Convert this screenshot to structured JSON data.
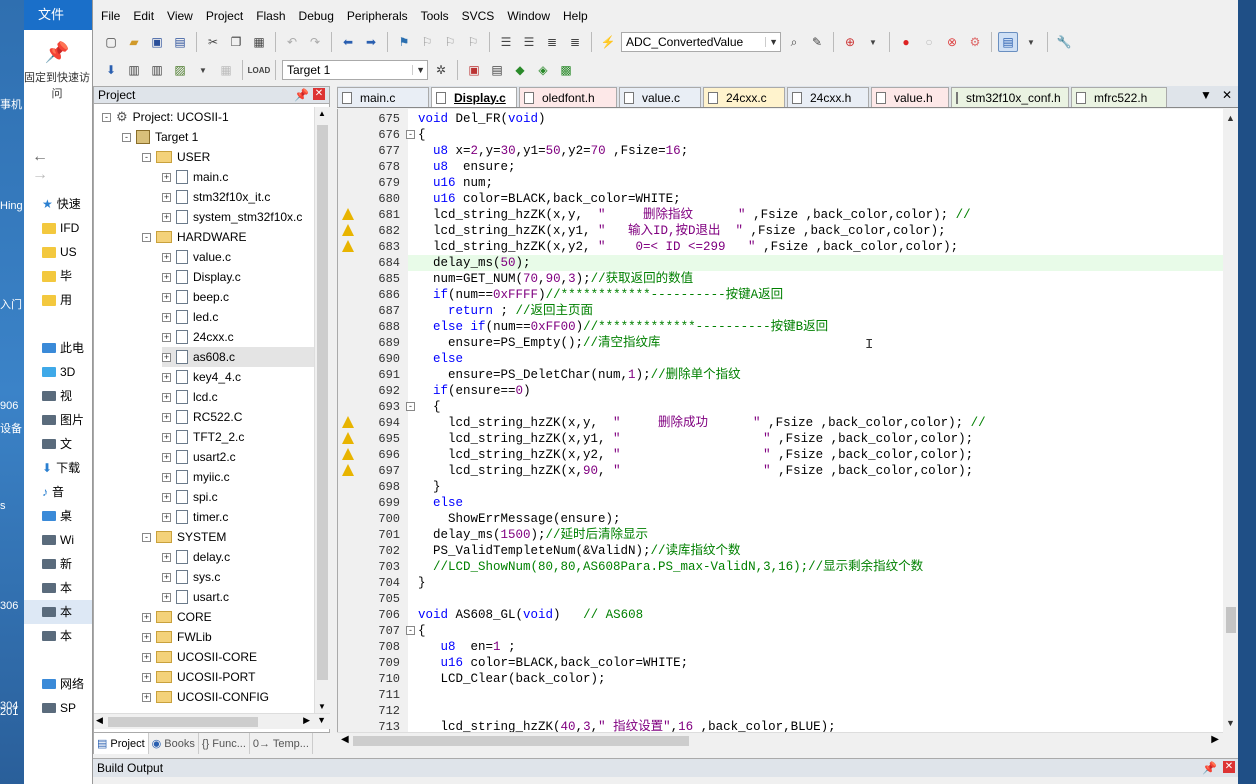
{
  "explorer": {
    "file_tab": "文件",
    "pin_label": "固定到快速访问",
    "nav_back": "←",
    "nav_fwd": "→",
    "items": [
      {
        "label": "快速",
        "kind": "star"
      },
      {
        "label": "IFD",
        "kind": "folder"
      },
      {
        "label": "US",
        "kind": "folder"
      },
      {
        "label": "毕",
        "kind": "folder"
      },
      {
        "label": "用",
        "kind": "folder"
      },
      {
        "label": "",
        "kind": "blank"
      },
      {
        "label": "此电",
        "kind": "pc"
      },
      {
        "label": "3D",
        "kind": "obj"
      },
      {
        "label": "视",
        "kind": "video"
      },
      {
        "label": "图片",
        "kind": "pics"
      },
      {
        "label": "文",
        "kind": "doc"
      },
      {
        "label": "下载",
        "kind": "down"
      },
      {
        "label": "音",
        "kind": "music"
      },
      {
        "label": "桌",
        "kind": "desk"
      },
      {
        "label": "Wi",
        "kind": "drive"
      },
      {
        "label": "新",
        "kind": "drive"
      },
      {
        "label": "本",
        "kind": "drive"
      },
      {
        "label": "本",
        "kind": "drive",
        "selected": true
      },
      {
        "label": "本",
        "kind": "drive"
      },
      {
        "label": "",
        "kind": "blank"
      },
      {
        "label": "网络",
        "kind": "net"
      },
      {
        "label": "SP",
        "kind": "drive"
      }
    ]
  },
  "desktop_labels": [
    "事机",
    "Hing",
    "入门",
    "906",
    "设备",
    "s",
    "306",
    "304",
    "201"
  ],
  "menu": [
    "File",
    "Edit",
    "View",
    "Project",
    "Flash",
    "Debug",
    "Peripherals",
    "Tools",
    "SVCS",
    "Window",
    "Help"
  ],
  "toolbar": {
    "find_combo": "ADC_ConvertedValue",
    "target_combo": "Target 1"
  },
  "project_pane": {
    "title": "Project",
    "tree": [
      {
        "label": "Project: UCOSII-1",
        "level": 0,
        "kind": "project",
        "exp": "-"
      },
      {
        "label": "Target 1",
        "level": 1,
        "kind": "target",
        "exp": "-"
      },
      {
        "label": "USER",
        "level": 2,
        "kind": "folder",
        "exp": "-"
      },
      {
        "label": "main.c",
        "level": 3,
        "kind": "file",
        "exp": "+"
      },
      {
        "label": "stm32f10x_it.c",
        "level": 3,
        "kind": "file",
        "exp": "+"
      },
      {
        "label": "system_stm32f10x.c",
        "level": 3,
        "kind": "file",
        "exp": "+"
      },
      {
        "label": "HARDWARE",
        "level": 2,
        "kind": "folder",
        "exp": "-"
      },
      {
        "label": "value.c",
        "level": 3,
        "kind": "file",
        "exp": "+"
      },
      {
        "label": "Display.c",
        "level": 3,
        "kind": "file",
        "exp": "+"
      },
      {
        "label": "beep.c",
        "level": 3,
        "kind": "file",
        "exp": "+"
      },
      {
        "label": "led.c",
        "level": 3,
        "kind": "file",
        "exp": "+"
      },
      {
        "label": "24cxx.c",
        "level": 3,
        "kind": "file",
        "exp": "+"
      },
      {
        "label": "as608.c",
        "level": 3,
        "kind": "file",
        "exp": "+",
        "selected": true
      },
      {
        "label": "key4_4.c",
        "level": 3,
        "kind": "file",
        "exp": "+"
      },
      {
        "label": "lcd.c",
        "level": 3,
        "kind": "file",
        "exp": "+"
      },
      {
        "label": "RC522.C",
        "level": 3,
        "kind": "file",
        "exp": "+"
      },
      {
        "label": "TFT2_2.c",
        "level": 3,
        "kind": "file",
        "exp": "+"
      },
      {
        "label": "usart2.c",
        "level": 3,
        "kind": "file",
        "exp": "+"
      },
      {
        "label": "myiic.c",
        "level": 3,
        "kind": "file",
        "exp": "+"
      },
      {
        "label": "spi.c",
        "level": 3,
        "kind": "file",
        "exp": "+"
      },
      {
        "label": "timer.c",
        "level": 3,
        "kind": "file",
        "exp": "+"
      },
      {
        "label": "SYSTEM",
        "level": 2,
        "kind": "folder",
        "exp": "-"
      },
      {
        "label": "delay.c",
        "level": 3,
        "kind": "file",
        "exp": "+"
      },
      {
        "label": "sys.c",
        "level": 3,
        "kind": "file",
        "exp": "+"
      },
      {
        "label": "usart.c",
        "level": 3,
        "kind": "file",
        "exp": "+"
      },
      {
        "label": "CORE",
        "level": 2,
        "kind": "folder",
        "exp": "+"
      },
      {
        "label": "FWLib",
        "level": 2,
        "kind": "folder",
        "exp": "+"
      },
      {
        "label": "UCOSII-CORE",
        "level": 2,
        "kind": "folder",
        "exp": "+"
      },
      {
        "label": "UCOSII-PORT",
        "level": 2,
        "kind": "folder",
        "exp": "+"
      },
      {
        "label": "UCOSII-CONFIG",
        "level": 2,
        "kind": "folder",
        "exp": "+"
      }
    ],
    "tabs": [
      "Project",
      "Books",
      "{} Func...",
      "0→ Temp..."
    ]
  },
  "editor_tabs": [
    {
      "label": "main.c",
      "style": "c"
    },
    {
      "label": "Display.c",
      "style": "act"
    },
    {
      "label": "oledfont.h",
      "style": "cr"
    },
    {
      "label": "value.c",
      "style": "c"
    },
    {
      "label": "24cxx.c",
      "style": "hy"
    },
    {
      "label": "24cxx.h",
      "style": "c"
    },
    {
      "label": "value.h",
      "style": "cr"
    },
    {
      "label": "stm32f10x_conf.h",
      "style": "h"
    },
    {
      "label": "mfrc522.h",
      "style": "h"
    }
  ],
  "code_lines": [
    {
      "n": "675",
      "t": "void Del_FR(void)"
    },
    {
      "n": "676",
      "t": "{",
      "fold": "-"
    },
    {
      "n": "677",
      "t": "  u8 x=2,y=30,y1=50,y2=70 ,Fsize=16;"
    },
    {
      "n": "678",
      "t": "  u8  ensure;"
    },
    {
      "n": "679",
      "t": "  u16 num;"
    },
    {
      "n": "680",
      "t": "  u16 color=BLACK,back_color=WHITE;"
    },
    {
      "n": "681",
      "t": "  lcd_string_hzZK(x,y,  \"     删除指纹      \" ,Fsize ,back_color,color); //",
      "warn": true
    },
    {
      "n": "682",
      "t": "  lcd_string_hzZK(x,y1, \"   输入ID,按D退出  \" ,Fsize ,back_color,color);",
      "warn": true
    },
    {
      "n": "683",
      "t": "  lcd_string_hzZK(x,y2, \"    0=< ID <=299   \" ,Fsize ,back_color,color);",
      "warn": true
    },
    {
      "n": "684",
      "t": "  delay_ms(50);",
      "hl": true
    },
    {
      "n": "685",
      "t": "  num=GET_NUM(70,90,3);//获取返回的数值"
    },
    {
      "n": "686",
      "t": "  if(num==0xFFFF)//************----------按键A返回"
    },
    {
      "n": "687",
      "t": "    return ; //返回主页面"
    },
    {
      "n": "688",
      "t": "  else if(num==0xFF00)//*************----------按键B返回"
    },
    {
      "n": "689",
      "t": "    ensure=PS_Empty();//清空指纹库"
    },
    {
      "n": "690",
      "t": "  else"
    },
    {
      "n": "691",
      "t": "    ensure=PS_DeletChar(num,1);//删除单个指纹"
    },
    {
      "n": "692",
      "t": "  if(ensure==0)"
    },
    {
      "n": "693",
      "t": "  {",
      "fold": "-"
    },
    {
      "n": "694",
      "t": "    lcd_string_hzZK(x,y,  \"     删除成功      \" ,Fsize ,back_color,color); //",
      "warn": true
    },
    {
      "n": "695",
      "t": "    lcd_string_hzZK(x,y1, \"                   \" ,Fsize ,back_color,color);",
      "warn": true
    },
    {
      "n": "696",
      "t": "    lcd_string_hzZK(x,y2, \"                   \" ,Fsize ,back_color,color);",
      "warn": true
    },
    {
      "n": "697",
      "t": "    lcd_string_hzZK(x,90, \"                   \" ,Fsize ,back_color,color);",
      "warn": true
    },
    {
      "n": "698",
      "t": "  }"
    },
    {
      "n": "699",
      "t": "  else"
    },
    {
      "n": "700",
      "t": "    ShowErrMessage(ensure);"
    },
    {
      "n": "701",
      "t": "  delay_ms(1500);//延时后清除显示"
    },
    {
      "n": "702",
      "t": "  PS_ValidTempleteNum(&ValidN);//读库指纹个数"
    },
    {
      "n": "703",
      "t": "  //LCD_ShowNum(80,80,AS608Para.PS_max-ValidN,3,16);//显示剩余指纹个数"
    },
    {
      "n": "704",
      "t": "}"
    },
    {
      "n": "705",
      "t": ""
    },
    {
      "n": "706",
      "t": "void AS608_GL(void)   // AS608"
    },
    {
      "n": "707",
      "t": "{",
      "fold": "-"
    },
    {
      "n": "708",
      "t": "   u8  en=1 ;"
    },
    {
      "n": "709",
      "t": "   u16 color=BLACK,back_color=WHITE;"
    },
    {
      "n": "710",
      "t": "   LCD_Clear(back_color);"
    },
    {
      "n": "711",
      "t": ""
    },
    {
      "n": "712",
      "t": ""
    },
    {
      "n": "713",
      "t": "   lcd_string_hzZK(40,3,\" 指纹设置\",16 ,back_color,BLUE);"
    }
  ],
  "build_output": {
    "title": "Build Output"
  },
  "colors": {
    "keyword": "#0000ff",
    "number": "#800080",
    "comment": "#008000",
    "string": "#800080",
    "warning": "#e8b400"
  }
}
